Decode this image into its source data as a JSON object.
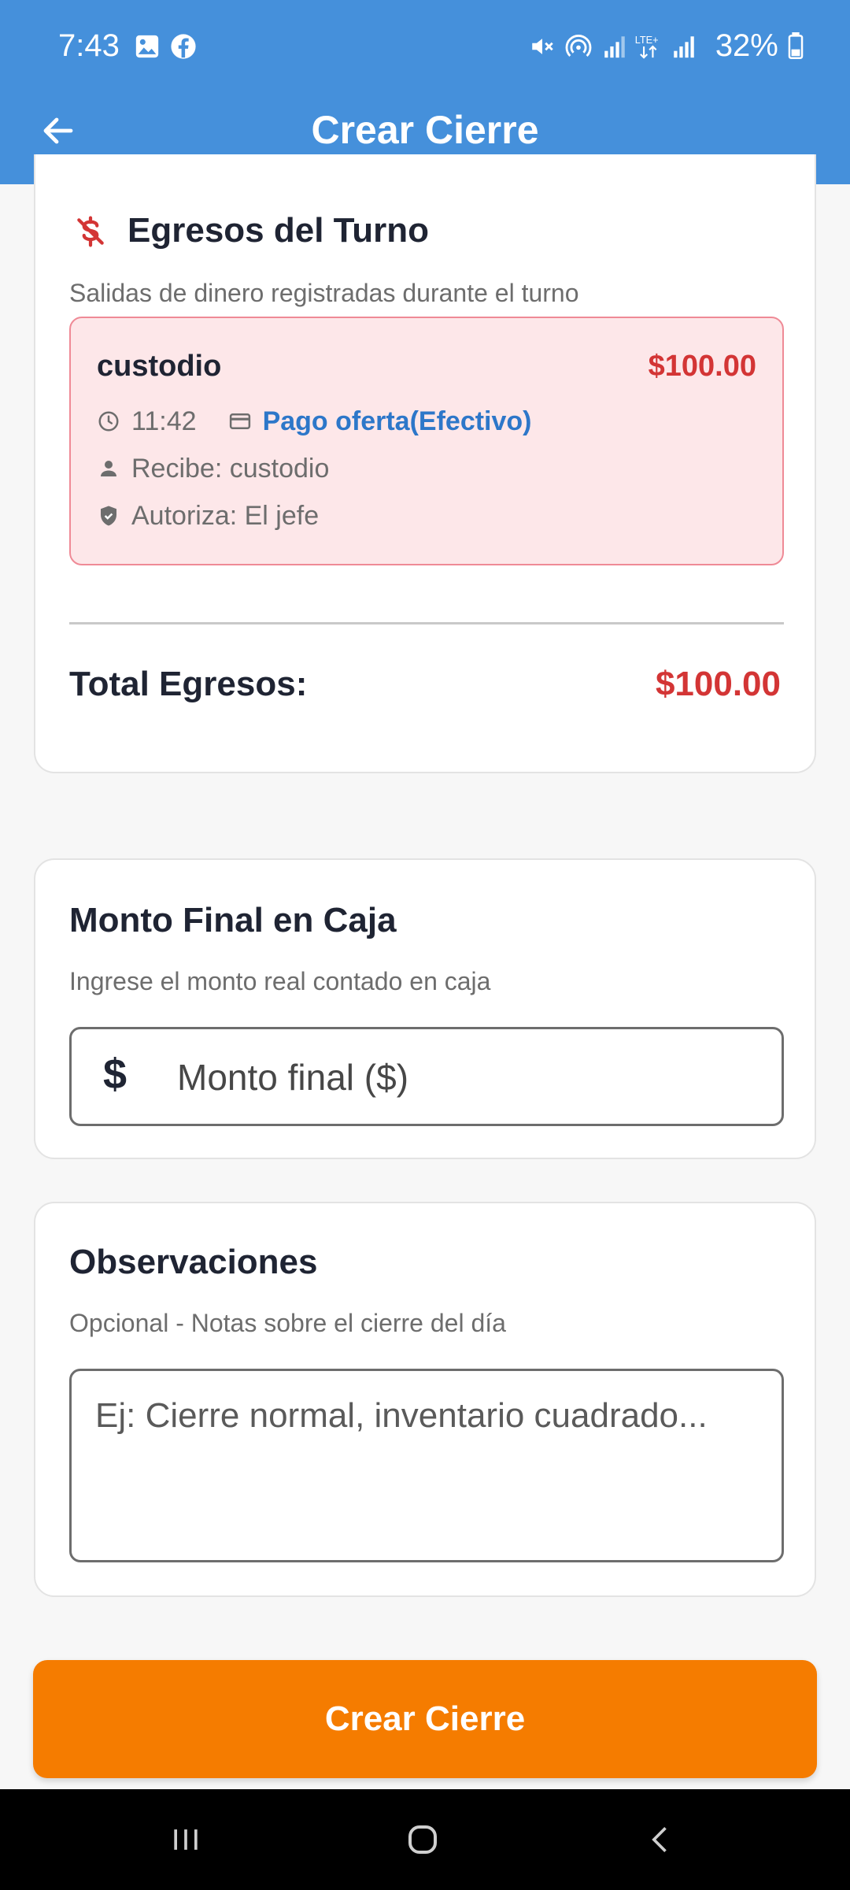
{
  "status_bar": {
    "time": "7:43",
    "battery": "32%",
    "icons": [
      "image-icon",
      "facebook-icon",
      "mute-icon",
      "hotspot-icon",
      "signal-icon",
      "lte-signal-icon",
      "signal-icon",
      "battery-icon"
    ]
  },
  "header": {
    "title": "Crear Cierre",
    "back_icon": "arrow-left-icon"
  },
  "egresos": {
    "title": "Egresos del Turno",
    "subtitle": "Salidas de dinero registradas durante el turno",
    "items": [
      {
        "name": "custodio",
        "amount": "$100.00",
        "time": "11:42",
        "method": "Pago oferta(Efectivo)",
        "receiver": "Recibe: custodio",
        "authorizer": "Autoriza: El jefe"
      }
    ],
    "total_label": "Total Egresos:",
    "total_value": "$100.00"
  },
  "monto_final": {
    "title": "Monto Final en Caja",
    "subtitle": "Ingrese el monto real contado en caja",
    "prefix": "$",
    "placeholder": "Monto final ($)",
    "value": ""
  },
  "observaciones": {
    "title": "Observaciones",
    "subtitle": "Opcional - Notas sobre el cierre del día",
    "placeholder": "Ej: Cierre normal, inventario cuadrado...",
    "value": ""
  },
  "submit_label": "Crear Cierre",
  "colors": {
    "appbar": "#4590db",
    "accent": "#f57c00",
    "danger": "#d33535",
    "expense_bg": "#fde7e9",
    "link": "#2d77c9"
  }
}
